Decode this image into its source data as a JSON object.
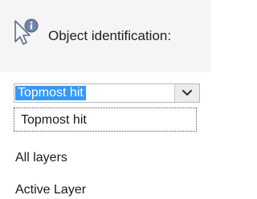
{
  "object_identification": {
    "label": "Object identification:",
    "icon": "pointer-info-icon",
    "combo": {
      "selected_value": "Topmost hit",
      "options": [
        "Topmost hit",
        "All layers",
        "Active Layer"
      ],
      "highlighted_index": 0
    }
  },
  "colors": {
    "selection": "#3399ff",
    "header_background": "#f5f5f5"
  }
}
